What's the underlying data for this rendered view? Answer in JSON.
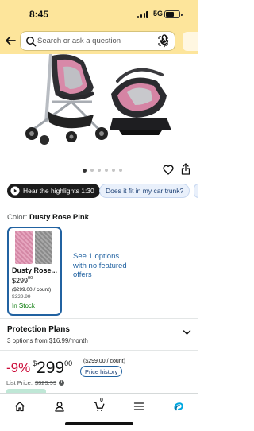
{
  "status_bar": {
    "time": "8:45",
    "network": "5G",
    "battery_level": 0.55
  },
  "header": {
    "search_placeholder": "Search or ask a question"
  },
  "gallery": {
    "image_label": "Stroller with infant car seat",
    "slide_count": 6,
    "active_slide": 0
  },
  "chips": {
    "highlights": "Hear the highlights 1:30",
    "question": "Does it fit in my car trunk?"
  },
  "color": {
    "label": "Color:",
    "value": "Dusty Rose Pink"
  },
  "swatch": {
    "name": "Dusty Rose...",
    "price_whole": "$299",
    "price_cents": "00",
    "unit_price": "($299.00 / count)",
    "list_price": "$329.99",
    "stock": "In Stock"
  },
  "see_options": "See 1 options with no featured offers",
  "protection": {
    "title": "Protection Plans",
    "subtitle": "3 options from $16.99/month"
  },
  "pricing": {
    "discount": "-9%",
    "currency": "$",
    "whole": "299",
    "cents": "00",
    "unit_price": "($299.00 / count)",
    "history_label": "Price history",
    "list_price_label": "List Price:",
    "list_price": "$329.99"
  },
  "bottom_nav": {
    "items": [
      {
        "icon": "home-icon"
      },
      {
        "icon": "account-icon"
      },
      {
        "icon": "cart-icon",
        "count": "0"
      },
      {
        "icon": "menu-icon"
      },
      {
        "icon": "rufus-icon"
      }
    ]
  },
  "colors": {
    "header_bg": "#fde59b",
    "link": "#2162a1",
    "deal": "#cc0c39",
    "stock": "#007600",
    "rufus": "#00a8e1"
  }
}
